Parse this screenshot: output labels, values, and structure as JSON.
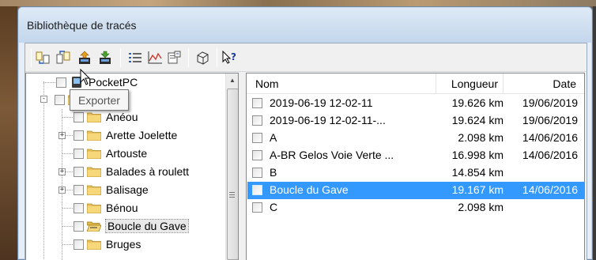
{
  "window": {
    "title": "Bibliothèque de tracés"
  },
  "toolbar": {
    "buttons": [
      {
        "icon": "import-icon"
      },
      {
        "icon": "export-icon"
      },
      {
        "icon": "upload-device-icon"
      },
      {
        "icon": "download-device-icon"
      },
      {
        "icon": "list-view-icon"
      },
      {
        "icon": "profile-chart-icon"
      },
      {
        "icon": "properties-icon"
      },
      {
        "icon": "3d-view-icon"
      },
      {
        "icon": "help-pointer-icon"
      }
    ]
  },
  "tooltip": {
    "text": "Exporter"
  },
  "tree": {
    "items": [
      {
        "label": "PocketPC",
        "level": 1,
        "expander": "",
        "icon": "device"
      },
      {
        "label": "",
        "level": 0,
        "expander": "-",
        "icon": "folder"
      },
      {
        "label": "Anéou",
        "level": 2,
        "expander": "",
        "icon": "folder"
      },
      {
        "label": "Arette Joelette",
        "level": 2,
        "expander": "+",
        "icon": "folder"
      },
      {
        "label": "Artouste",
        "level": 2,
        "expander": "",
        "icon": "folder"
      },
      {
        "label": "Balades à roulett",
        "level": 2,
        "expander": "+",
        "icon": "folder"
      },
      {
        "label": "Balisage",
        "level": 2,
        "expander": "+",
        "icon": "folder"
      },
      {
        "label": "Bénou",
        "level": 2,
        "expander": "",
        "icon": "folder"
      },
      {
        "label": "Boucle du Gave",
        "level": 2,
        "expander": "",
        "icon": "folder-open",
        "selected": true
      },
      {
        "label": "Bruges",
        "level": 2,
        "expander": "",
        "icon": "folder"
      }
    ]
  },
  "list": {
    "columns": {
      "name": "Nom",
      "length": "Longueur",
      "date": "Date"
    },
    "rows": [
      {
        "name": "2019-06-19 12-02-11",
        "length": "19.626 km",
        "date": "19/06/2019",
        "selected": false
      },
      {
        "name": "2019-06-19 12-02-11-...",
        "length": "19.624 km",
        "date": "19/06/2019",
        "selected": false
      },
      {
        "name": "A",
        "length": "2.098 km",
        "date": "14/06/2016",
        "selected": false
      },
      {
        "name": "A-BR Gelos Voie Verte ...",
        "length": "16.998 km",
        "date": "14/06/2016",
        "selected": false
      },
      {
        "name": "B",
        "length": "14.854 km",
        "date": "",
        "selected": false
      },
      {
        "name": "Boucle du Gave",
        "length": "19.167 km",
        "date": "14/06/2016",
        "selected": true
      },
      {
        "name": "C",
        "length": "2.098 km",
        "date": "",
        "selected": false
      }
    ]
  },
  "colors": {
    "selection": "#3399ff",
    "titlebar": "#cfdff0"
  }
}
